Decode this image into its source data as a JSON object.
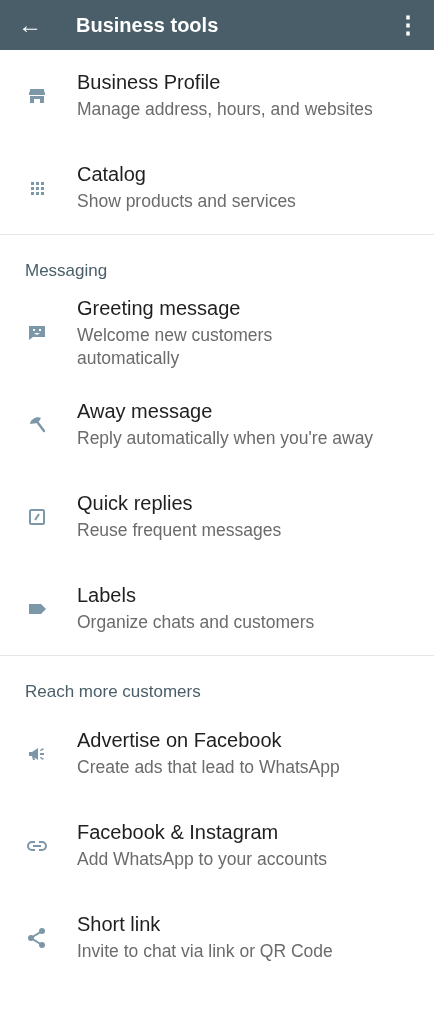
{
  "app_bar": {
    "back_icon": "←",
    "title": "Business tools",
    "menu_icon": "⋮"
  },
  "sections": [
    {
      "items": [
        {
          "title": "Business Profile",
          "subtitle": "Manage address, hours, and websites"
        },
        {
          "title": "Catalog",
          "subtitle": "Show products and services"
        }
      ]
    },
    {
      "header": "Messaging",
      "items": [
        {
          "title": "Greeting message",
          "subtitle": "Welcome new customers automatically"
        },
        {
          "title": "Away message",
          "subtitle": "Reply automatically when you're away"
        },
        {
          "title": "Quick replies",
          "subtitle": "Reuse frequent messages"
        },
        {
          "title": "Labels",
          "subtitle": "Organize chats and customers"
        }
      ]
    },
    {
      "header": "Reach more customers",
      "items": [
        {
          "title": "Advertise on Facebook",
          "subtitle": "Create ads that lead to WhatsApp"
        },
        {
          "title": "Facebook & Instagram",
          "subtitle": "Add WhatsApp to your accounts"
        },
        {
          "title": "Short link",
          "subtitle": "Invite to chat via link or QR Code"
        }
      ]
    }
  ]
}
